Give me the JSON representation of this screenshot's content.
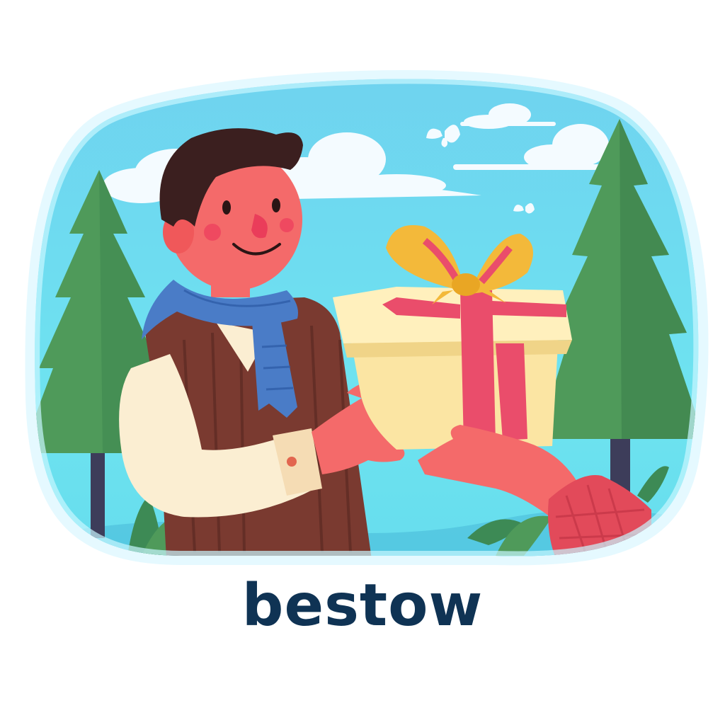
{
  "caption": {
    "word": "bestow"
  },
  "colors": {
    "caption": "#0f3354",
    "sky_top": "#7dd6f2",
    "sky_bottom": "#63e2ee",
    "cloud": "#f4fbff",
    "tree": "#4f9a5a",
    "tree_dark": "#3b7d4b",
    "skin": "#f46a6a",
    "hair": "#3b1f1f",
    "scarf": "#4a7cc7",
    "vest": "#7a3a30",
    "shirt": "#fbeed2",
    "gift_box": "#fbe5a3",
    "gift_ribbon": "#ea4d6b",
    "gift_bow": "#f3b93a",
    "sleeve_right": "#e24a5a"
  },
  "icons": {
    "butterfly_large": "butterfly-icon",
    "butterfly_small": "butterfly-icon"
  }
}
